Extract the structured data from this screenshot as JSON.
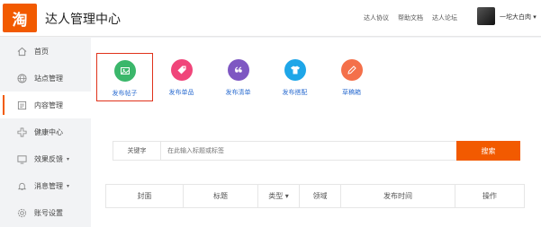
{
  "header": {
    "logo_char": "淘",
    "title": "达人管理中心",
    "links": [
      "达人协议",
      "帮助文档",
      "达人论坛"
    ],
    "username": "一坨大白肉 ▾"
  },
  "sidebar": {
    "items": [
      {
        "label": "首页",
        "icon": "home-icon"
      },
      {
        "label": "站点管理",
        "icon": "globe-icon"
      },
      {
        "label": "内容管理",
        "icon": "document-icon",
        "active": true
      },
      {
        "label": "健康中心",
        "icon": "plus-cross-icon"
      },
      {
        "label": "效果反馈",
        "icon": "monitor-icon",
        "caret": "▾"
      },
      {
        "label": "消息管理",
        "icon": "bell-icon",
        "caret": "▾"
      },
      {
        "label": "账号设置",
        "icon": "gear-icon"
      }
    ]
  },
  "actions": [
    {
      "label": "发布帖子",
      "icon": "image-post-icon",
      "color": "#3bb76b",
      "selected": true
    },
    {
      "label": "发布单品",
      "icon": "tag-icon",
      "color": "#f0457a"
    },
    {
      "label": "发布清单",
      "icon": "quote-icon",
      "color": "#7e57c2"
    },
    {
      "label": "发布搭配",
      "icon": "tshirt-icon",
      "color": "#1ea6e8"
    },
    {
      "label": "草稿箱",
      "icon": "pencil-icon",
      "color": "#f4704a"
    }
  ],
  "search": {
    "label": "关键字",
    "placeholder": "在此输入标题或标签",
    "button": "搜索"
  },
  "table": {
    "columns": [
      "封面",
      "标题",
      "类型 ▾",
      "领域",
      "发布时间",
      "操作"
    ]
  },
  "colors": {
    "brand": "#f25a00",
    "selected_border": "#e0321b",
    "link": "#2f6fd1"
  }
}
